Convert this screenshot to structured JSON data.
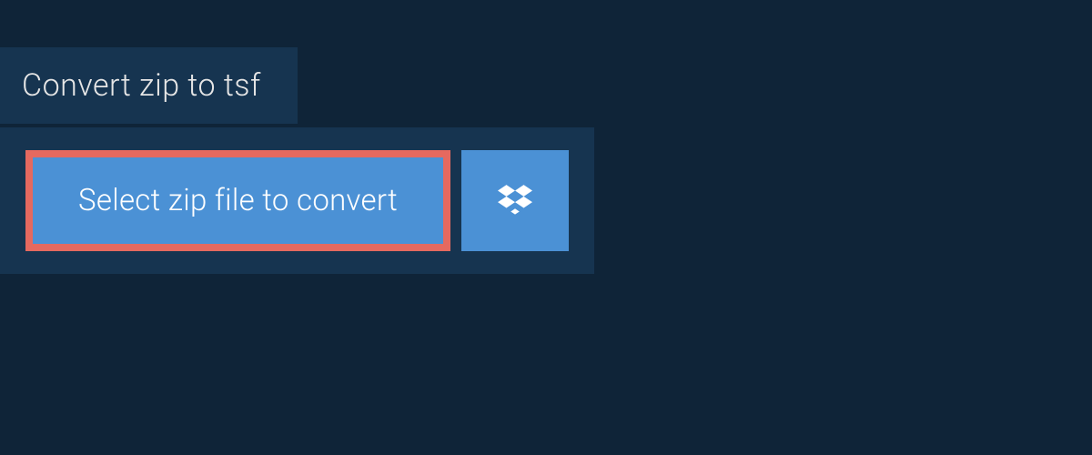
{
  "tab": {
    "title": "Convert zip to tsf"
  },
  "actions": {
    "select_file_label": "Select zip file to convert",
    "dropbox_icon": "dropbox"
  },
  "colors": {
    "background": "#0f2438",
    "panel": "#163450",
    "button": "#4b91d5",
    "highlight_border": "#e5695f",
    "text_light": "#e6e6e6",
    "text_white": "#ffffff"
  }
}
